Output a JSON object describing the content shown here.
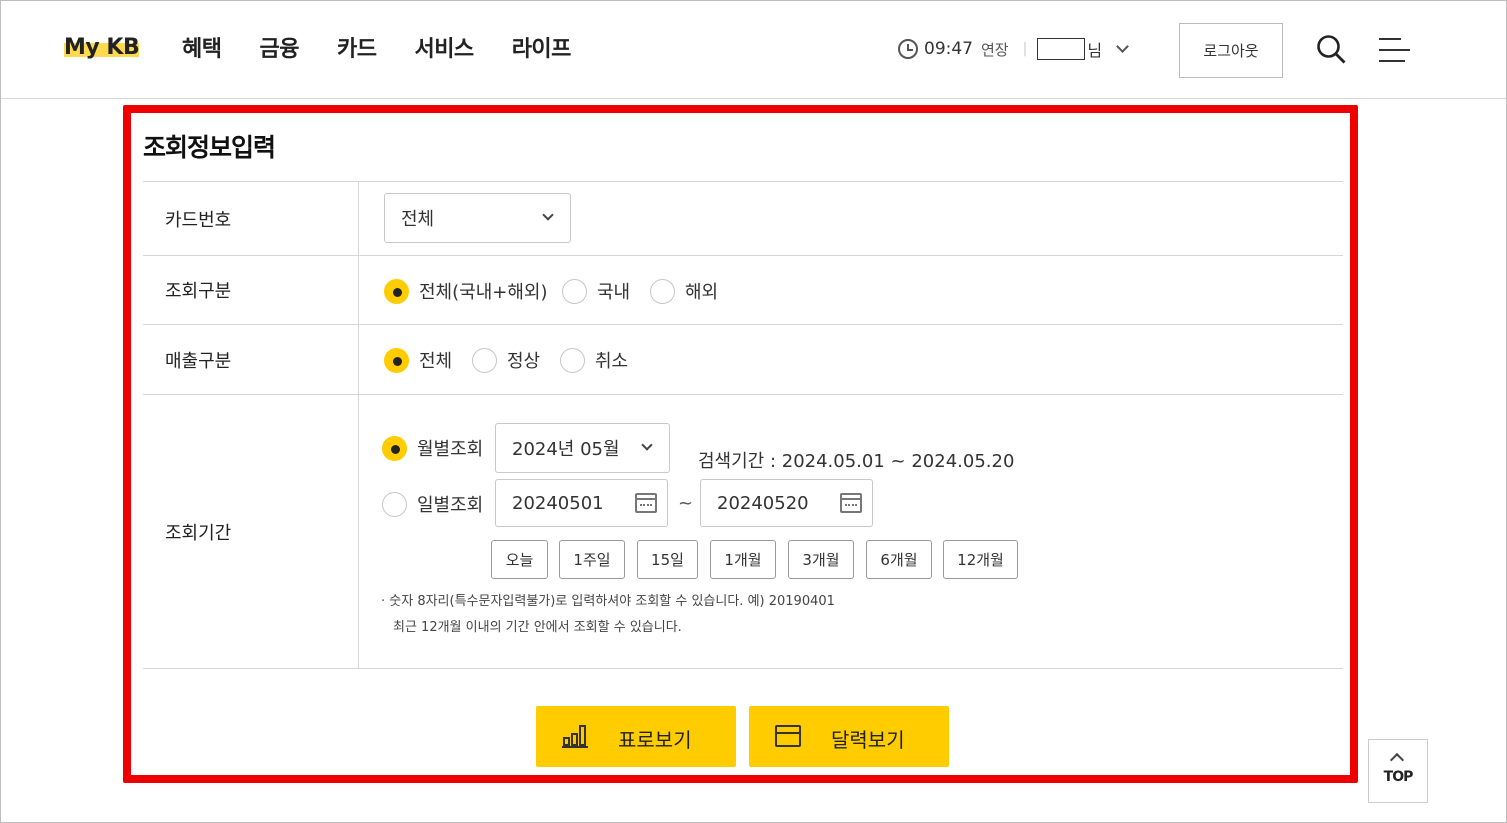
{
  "header": {
    "logo": "My KB",
    "nav": [
      "혜택",
      "금융",
      "카드",
      "서비스",
      "라이프"
    ],
    "time": "09:47",
    "extend_label": "연장",
    "user_suffix": "님",
    "logout_label": "로그아웃"
  },
  "form": {
    "title": "조회정보입력",
    "card_number": {
      "label": "카드번호",
      "selected": "전체"
    },
    "inquiry_type": {
      "label": "조회구분",
      "options": [
        "전체(국내+해외)",
        "국내",
        "해외"
      ],
      "selected": "전체(국내+해외)"
    },
    "sales_type": {
      "label": "매출구분",
      "options": [
        "전체",
        "정상",
        "취소"
      ],
      "selected": "전체"
    },
    "period": {
      "label": "조회기간",
      "monthly_label": "월별조회",
      "monthly_value": "2024년 05월",
      "search_range": "검색기간 : 2024.05.01 ~ 2024.05.20",
      "daily_label": "일별조회",
      "start_date": "20240501",
      "end_date": "20240520",
      "tilde": "~",
      "selected_mode": "monthly",
      "quick_buttons": [
        "오늘",
        "1주일",
        "15일",
        "1개월",
        "3개월",
        "6개월",
        "12개월"
      ],
      "note1": "· 숫자 8자리(특수문자입력불가)로 입력하셔야 조회할 수 있습니다. 예) 20190401",
      "note2": "최근 12개월 이내의 기간 안에서 조회할 수 있습니다."
    },
    "table_view_label": "표로보기",
    "calendar_view_label": "달력보기"
  },
  "top_button": "TOP",
  "colors": {
    "accent": "#ffcc00",
    "highlight_border": "#ee0000"
  },
  "icons": [
    "clock-icon",
    "chevron-down-icon",
    "search-icon",
    "menu-icon",
    "calendar-icon",
    "bar-chart-icon",
    "arrow-up-icon"
  ]
}
